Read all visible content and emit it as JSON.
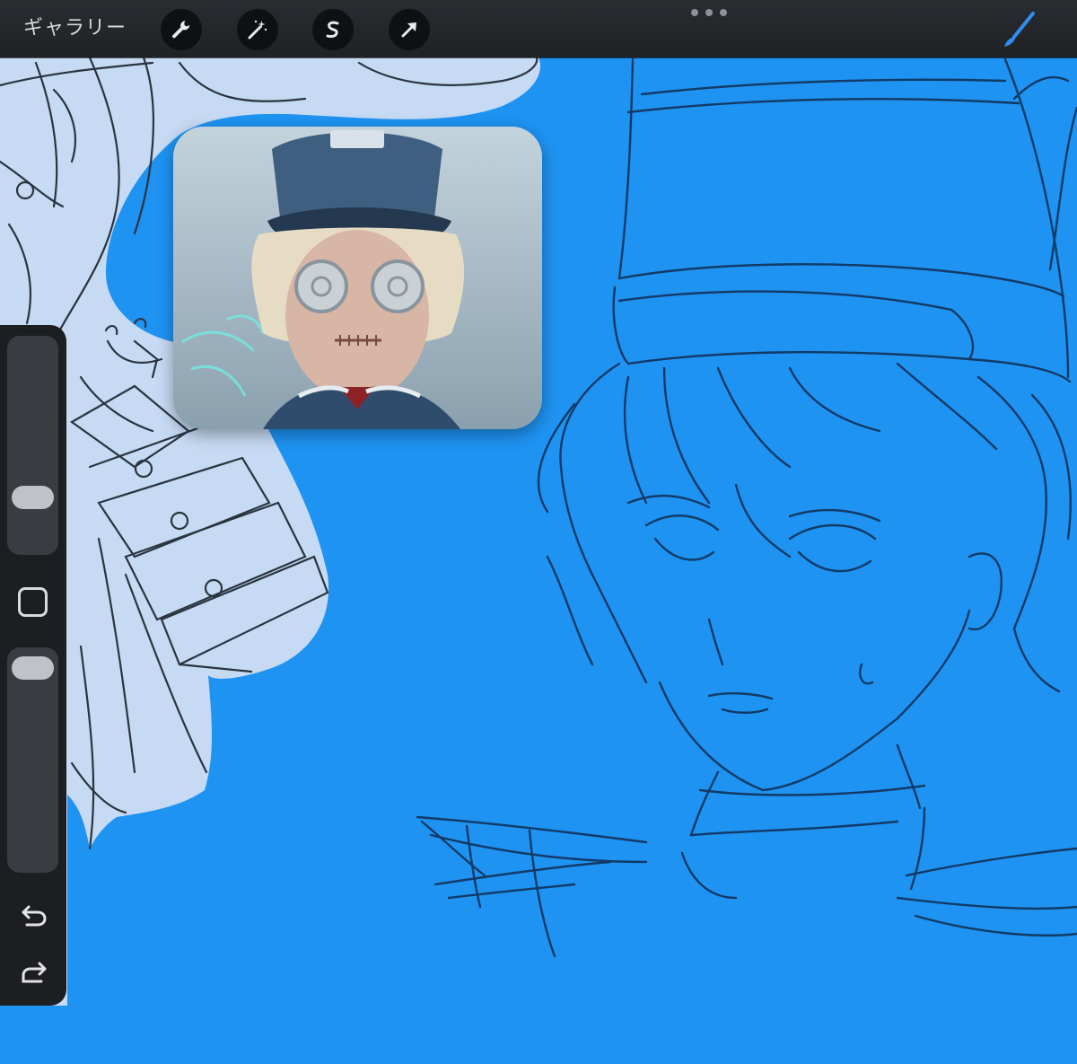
{
  "toolbar": {
    "gallery_label": "ギャラリー",
    "tools": [
      {
        "name": "actions",
        "icon": "wrench-icon"
      },
      {
        "name": "adjustments",
        "icon": "magic-wand-icon"
      },
      {
        "name": "selection",
        "icon": "selection-s-icon"
      },
      {
        "name": "transform",
        "icon": "arrow-cursor-icon"
      }
    ],
    "more_icon": "more-dots-icon",
    "active_tool_icon": "brush-icon",
    "accent_color": "#2e8ff0"
  },
  "canvas": {
    "background_color": "#1e93f2"
  },
  "sidebar": {
    "brush_size_slider": 0.68,
    "opacity_slider": 0.04,
    "modify_button_icon": "square-icon",
    "undo_icon": "undo-icon",
    "redo_icon": "redo-icon"
  },
  "reference_window": {
    "icon": "reference-image"
  }
}
